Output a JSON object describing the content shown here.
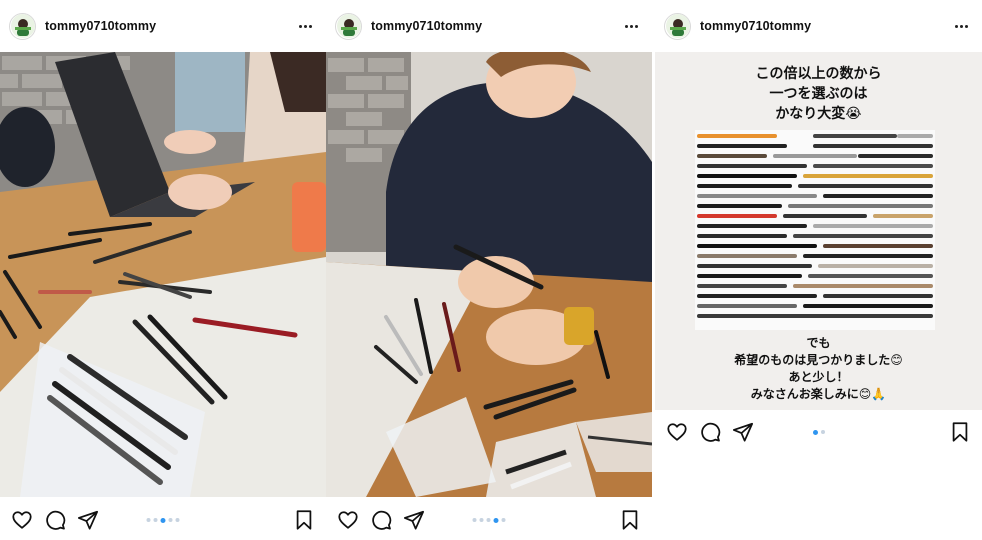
{
  "posts": [
    {
      "username": "tommy0710tommy",
      "media_description_icon": "photo-people-at-table-with-pencils",
      "carousel": {
        "count": 5,
        "active": 2
      }
    },
    {
      "username": "tommy0710tommy",
      "media_description_icon": "photo-man-holding-pencil",
      "carousel": {
        "count": 5,
        "active": 3
      }
    },
    {
      "username": "tommy0710tommy",
      "media_description_icon": "photo-eyebrow-pencils-collage",
      "caption_top": [
        "この倍以上の数から",
        "一つを選ぶのは",
        "かなり大変😭"
      ],
      "caption_bottom": [
        "でも",
        "希望のものは見つかりました😊",
        "あと少し！",
        "みなさんお楽しみに😊🙏"
      ],
      "carousel": {
        "count": 2,
        "active": 0
      }
    }
  ],
  "icons": {
    "like": "heart-icon",
    "comment": "comment-icon",
    "share": "share-icon",
    "save": "bookmark-icon",
    "more": "more-options-icon"
  },
  "colors": {
    "carousel_active": "#2f95f0",
    "carousel_inactive": "#c7d3e0"
  }
}
